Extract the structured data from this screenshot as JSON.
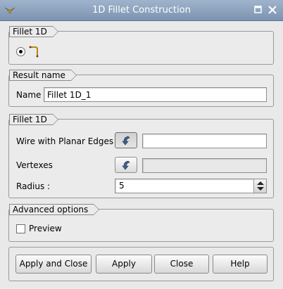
{
  "window": {
    "title": "1D Fillet Construction",
    "icon": "app-icon",
    "maximize_icon": "maximize-icon",
    "close_icon": "close-icon"
  },
  "constructor_group": {
    "label": "Fillet 1D",
    "radio_selected": true,
    "radio_icon": "fillet-1d-icon"
  },
  "result_group": {
    "label": "Result name",
    "name_label": "Name",
    "name_value": "Fillet 1D_1"
  },
  "args_group": {
    "label": "Fillet 1D",
    "wire_label": "Wire with Planar Edges",
    "wire_value": "",
    "vertexes_label": "Vertexes",
    "vertexes_value": "",
    "radius_label": "Radius :",
    "radius_value": "5",
    "select_icon": "select-arrow-icon"
  },
  "advanced_group": {
    "label": "Advanced options",
    "preview_label": "Preview",
    "preview_checked": false
  },
  "buttons": {
    "apply_close": "Apply and Close",
    "apply": "Apply",
    "close": "Close",
    "help": "Help"
  },
  "colors": {
    "titlebar_top": "#9fb4cc",
    "titlebar_bottom": "#7c93b0",
    "window_bg": "#e9e9e9",
    "select_arrow": "#3f5e8c"
  }
}
